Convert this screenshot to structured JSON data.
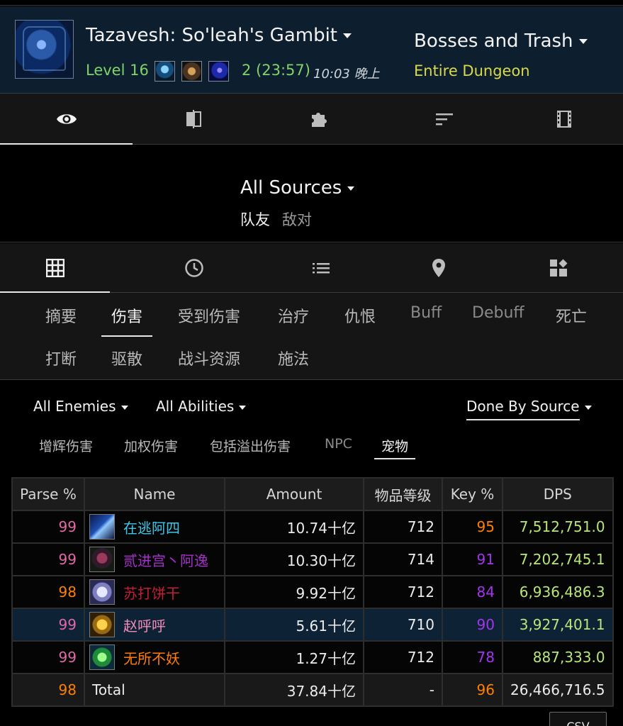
{
  "header": {
    "dungeon": "Tazavesh: So'leah's Gambit",
    "level": "Level 16",
    "run": "2 (23:57)",
    "time": "10:03 晚上",
    "fight": "Bosses and Trash",
    "fight_sub": "Entire Dungeon",
    "affixes": [
      "affix-1",
      "affix-2",
      "affix-3"
    ]
  },
  "view_tabs": [
    {
      "icon": "eye-icon",
      "active": true
    },
    {
      "icon": "compare-icon",
      "active": false
    },
    {
      "icon": "puzzle-icon",
      "active": false
    },
    {
      "icon": "sort-icon",
      "active": false
    },
    {
      "icon": "film-icon",
      "active": false
    }
  ],
  "sources": {
    "title": "All Sources",
    "friendly": "队友",
    "hostile": "敌对"
  },
  "panel_tabs": [
    {
      "icon": "grid-icon",
      "active": true
    },
    {
      "icon": "clock-icon",
      "active": false
    },
    {
      "icon": "list-icon",
      "active": false
    },
    {
      "icon": "location-pin-icon",
      "active": false
    },
    {
      "icon": "dashboard-icon",
      "active": false
    }
  ],
  "type_tabs": {
    "row1": [
      "摘要",
      "伤害",
      "受到伤害",
      "治疗",
      "仇恨",
      "Buff",
      "Debuff",
      "死亡"
    ],
    "row2": [
      "打断",
      "驱散",
      "战斗资源",
      "施法"
    ],
    "active": "伤害"
  },
  "filters": {
    "enemies": "All Enemies",
    "abilities": "All Abilities",
    "mode": "Done By Source",
    "sub": [
      "增辉伤害",
      "加权伤害",
      "包括溢出伤害",
      "NPC",
      "宠物"
    ],
    "sub_active": "宠物"
  },
  "table": {
    "headers": [
      "Parse %",
      "Name",
      "Amount",
      "物品等级",
      "Key %",
      "DPS"
    ],
    "rows": [
      {
        "parse": "99",
        "name": "在逃阿四",
        "amount": "10.74十亿",
        "ilvl": "712",
        "key": "95",
        "dps": "7,512,751.0"
      },
      {
        "parse": "99",
        "name": "贰进宫丶阿逸",
        "amount": "10.30十亿",
        "ilvl": "714",
        "key": "91",
        "dps": "7,202,745.1"
      },
      {
        "parse": "98",
        "name": "苏打饼干",
        "amount": "9.92十亿",
        "ilvl": "712",
        "key": "84",
        "dps": "6,936,486.3"
      },
      {
        "parse": "99",
        "name": "赵呼呼",
        "amount": "5.61十亿",
        "ilvl": "710",
        "key": "90",
        "dps": "3,927,401.1"
      },
      {
        "parse": "99",
        "name": "无所不妖",
        "amount": "1.27十亿",
        "ilvl": "712",
        "key": "78",
        "dps": "887,333.0"
      }
    ],
    "total": {
      "parse": "98",
      "name": "Total",
      "amount": "37.84十亿",
      "ilvl": "-",
      "key": "96",
      "dps": "26,466,716.5"
    }
  },
  "csv_label": "CSV",
  "colors": {
    "level_green": "#7fd36b",
    "fight_yellow": "#d9d94a",
    "parse_99": "#e268a8",
    "parse_98": "#ff8000",
    "dps_green": "#b7e67a",
    "name_mage": "#3fc7eb",
    "name_dh": "#a330c9",
    "name_dk": "#c41e3a",
    "name_paladin": "#f48cba",
    "name_evoker": "#ff7c0a"
  }
}
